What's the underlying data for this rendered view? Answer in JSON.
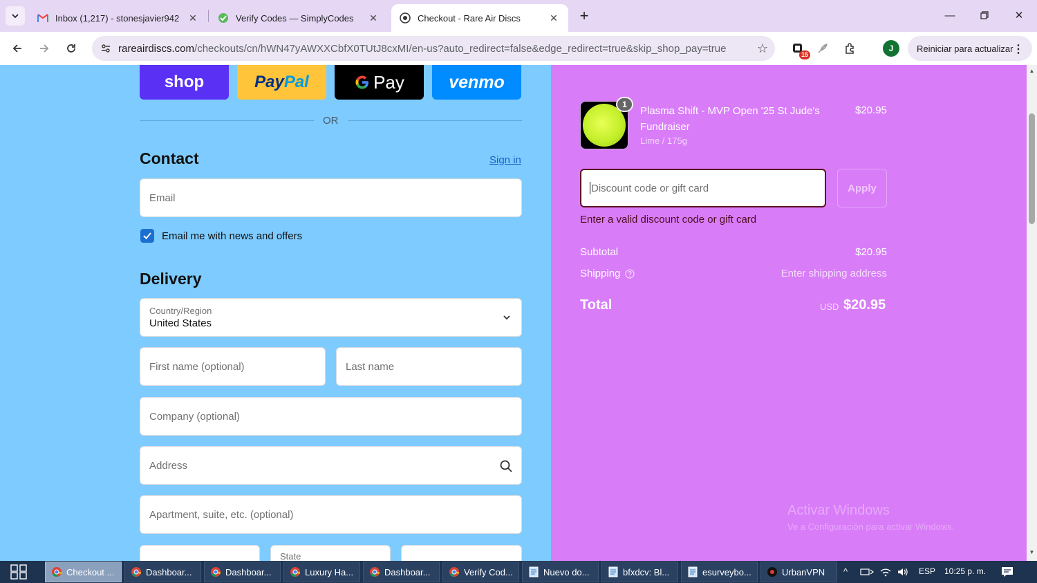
{
  "browser": {
    "tabs": [
      {
        "title": "Inbox (1,217) - stonesjavier942",
        "icon": "gmail-icon"
      },
      {
        "title": "Verify Codes — SimplyCodes",
        "icon": "simplycodes-icon"
      },
      {
        "title": "Checkout - Rare Air Discs",
        "icon": "rareair-icon"
      }
    ],
    "url_host": "rareairdiscs.com",
    "url_path": "/checkouts/cn/hWN47yAWXXCbfX0TUtJ8cxMI/en-us?auto_redirect=false&edge_redirect=true&skip_shop_pay=true",
    "extension_badge": "15",
    "profile_initial": "J",
    "update_label": "Reiniciar para actualizar"
  },
  "express": {
    "shop": "shop",
    "paypal_a": "Pay",
    "paypal_b": "Pal",
    "gpay": "Pay",
    "venmo": "venmo",
    "or": "OR"
  },
  "contact": {
    "title": "Contact",
    "signin": "Sign in",
    "email_placeholder": "Email",
    "newsletter_label": "Email me with news and offers"
  },
  "delivery": {
    "title": "Delivery",
    "country_label": "Country/Region",
    "country_value": "United States",
    "first_name": "First name (optional)",
    "last_name": "Last name",
    "company": "Company (optional)",
    "address": "Address",
    "apartment": "Apartment, suite, etc. (optional)",
    "state": "State"
  },
  "summary": {
    "item_qty": "1",
    "item_name": "Plasma Shift - MVP Open '25 St Jude's Fundraiser",
    "item_variant": "Lime / 175g",
    "item_price": "$20.95",
    "discount_placeholder": "Discount code or gift card",
    "apply": "Apply",
    "error": "Enter a valid discount code or gift card",
    "subtotal_label": "Subtotal",
    "subtotal_value": "$20.95",
    "shipping_label": "Shipping",
    "shipping_value": "Enter shipping address",
    "total_label": "Total",
    "total_currency": "USD",
    "total_value": "$20.95"
  },
  "watermark": {
    "line1": "Activar Windows",
    "line2": "Ve a Configuración para activar Windows."
  },
  "taskbar": {
    "items": [
      "Checkout ...",
      "Dashboar...",
      "Dashboar...",
      "Luxury Ha...",
      "Dashboar...",
      "Verify Cod...",
      "Nuevo do...",
      "bfxdcv: Bl...",
      "esurveybo...",
      "UrbanVPN"
    ],
    "lang": "ESP",
    "time": "10:25 p. m."
  },
  "colors": {
    "left_bg": "#7ecbff",
    "right_bg": "#d97cf8",
    "tabstrip": "#e6d8f5"
  }
}
